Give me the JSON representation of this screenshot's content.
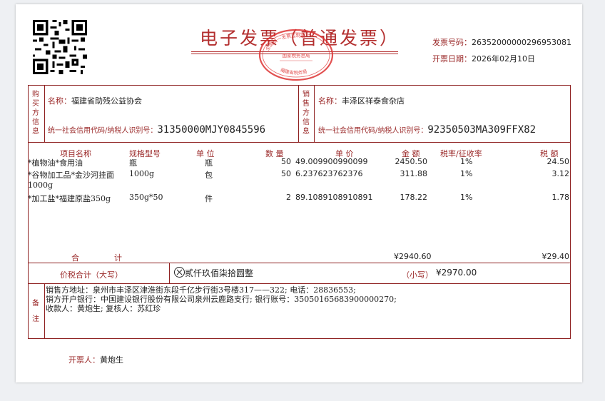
{
  "header": {
    "title": "电子发票（普通发票）",
    "seal_lines": [
      "全国统一发票监制章",
      "国家税务总局",
      "福建省税务局"
    ],
    "invoice_no_label": "发票号码：",
    "invoice_no": "26352000000296953081",
    "date_label": "开票日期：",
    "date": "2026年02月10日"
  },
  "buyer": {
    "side_label": [
      "购",
      "买",
      "方",
      "信",
      "息"
    ],
    "name_label": "名称：",
    "name": "福建省助残公益协会",
    "tax_label": "统一社会信用代码/纳税人识别号：",
    "tax_id": "31350000MJY0845596"
  },
  "seller": {
    "side_label": [
      "销",
      "售",
      "方",
      "信",
      "息"
    ],
    "name_label": "名称：",
    "name": "丰泽区祥泰食杂店",
    "tax_label": "统一社会信用代码/纳税人识别号：",
    "tax_id": "92350503MA309FFX82"
  },
  "items_header": {
    "name": "项目名称",
    "spec": "规格型号",
    "unit": "单 位",
    "qty": "数 量",
    "price": "单 价",
    "amount": "金 额",
    "rate": "税率/征收率",
    "tax": "税 额"
  },
  "items": [
    {
      "name": "*植物油*食用油",
      "name2": "",
      "spec": "瓶",
      "unit": "瓶",
      "qty": "50",
      "price": "49.009900990099",
      "amount": "2450.50",
      "rate": "1%",
      "tax": "24.50"
    },
    {
      "name": "*谷物加工品*金沙河挂面",
      "name2": "1000g",
      "spec": "1000g",
      "unit": "包",
      "qty": "50",
      "price": "6.237623762376",
      "amount": "311.88",
      "rate": "1%",
      "tax": "3.12"
    },
    {
      "name": "*加工盐*福建原盐350g",
      "name2": "",
      "spec": "350g*50",
      "unit": "件",
      "qty": "2",
      "price": "89.1089108910891",
      "amount": "178.22",
      "rate": "1%",
      "tax": "1.78"
    }
  ],
  "total": {
    "label1": "合",
    "label2": "计",
    "amount": "¥2940.60",
    "tax": "¥29.40"
  },
  "grand_total": {
    "label": "价税合计（大写）",
    "words": "贰仟玖佰柒拾圆整",
    "small_label": "（小写）",
    "small": "¥2970.00"
  },
  "remarks": {
    "side_label": [
      "备",
      "注"
    ],
    "line1": "销售方地址：泉州市丰泽区津淮街东段千亿步行街3号楼317——322;     电话：28836553;",
    "line2": "销方开户银行：中国建设银行股份有限公司泉州云鹿路支行;     银行账号：35050165683900000270;",
    "line3": "收款人：黄炮生;     复核人：苏红珍"
  },
  "issuer": {
    "label": "开票人：",
    "name": "黄炮生"
  },
  "colors": {
    "frame": "#8e2020",
    "label": "#9b2a2a",
    "title": "#b32e2e"
  }
}
